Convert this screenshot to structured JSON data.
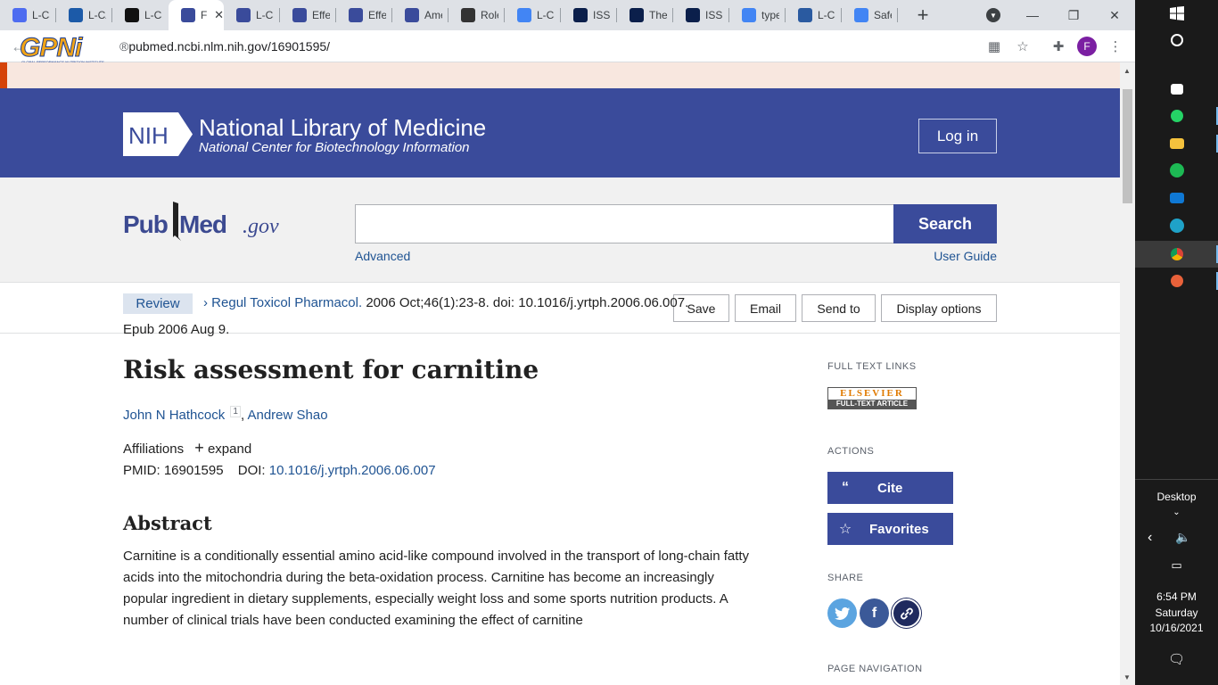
{
  "browser": {
    "tabs": [
      {
        "title": "L-Ca",
        "fav": "docs-icon",
        "color": "#4e6cf0"
      },
      {
        "title": "L-CA",
        "fav": "webmd-icon",
        "color": "#1c5aa8"
      },
      {
        "title": "L-Ca",
        "fav": "bolt-icon",
        "color": "#111111"
      },
      {
        "title": "F",
        "fav": "pubmed-tab-icon",
        "color": "#3a4b9b",
        "active": true
      },
      {
        "title": "L-Ca",
        "fav": "pubmed-tab-icon",
        "color": "#3a4b9b"
      },
      {
        "title": "Effe",
        "fav": "pubmed-tab-icon",
        "color": "#3a4b9b"
      },
      {
        "title": "Effe",
        "fav": "pubmed-tab-icon",
        "color": "#3a4b9b"
      },
      {
        "title": "Ame",
        "fav": "pubmed-tab-icon",
        "color": "#3a4b9b"
      },
      {
        "title": "Role",
        "fav": "dna-icon",
        "color": "#333333"
      },
      {
        "title": "L-Ca",
        "fav": "google-icon",
        "color": "#4285f4"
      },
      {
        "title": "ISSN",
        "fav": "issn-icon",
        "color": "#0b1f4b"
      },
      {
        "title": "The",
        "fav": "issn-icon",
        "color": "#0b1f4b"
      },
      {
        "title": "ISSN",
        "fav": "issn-icon",
        "color": "#0b1f4b"
      },
      {
        "title": "type",
        "fav": "google-icon",
        "color": "#4285f4"
      },
      {
        "title": "L-Ca",
        "fav": "site-icon",
        "color": "#2a5aa0"
      },
      {
        "title": "Safe",
        "fav": "google-icon",
        "color": "#4285f4"
      }
    ],
    "url": "pubmed.ncbi.nlm.nih.gov/16901595/",
    "profile_initial": "F",
    "overlay_logo": "GPNi",
    "overlay_logo_sub": "GLOBAL PERFORMANCE NUTRITION INSTITUTE"
  },
  "nih": {
    "logo": "NIH",
    "title": "National Library of Medicine",
    "subtitle": "National Center for Biotechnology Information",
    "login": "Log in"
  },
  "search": {
    "logo_pub": "Pub",
    "logo_med": "Med",
    "logo_gov": ".gov",
    "button": "Search",
    "advanced": "Advanced",
    "user_guide": "User Guide",
    "value": ""
  },
  "actions_bar": {
    "save": "Save",
    "email": "Email",
    "send_to": "Send to",
    "display_options": "Display options"
  },
  "article": {
    "badge": "Review",
    "journal": "Regul Toxicol Pharmacol.",
    "citation": " 2006 Oct;46(1):23-8. doi: 10.1016/j.yrtph.2006.06.007.",
    "epub": "Epub 2006 Aug 9.",
    "title": "Risk assessment for carnitine",
    "author1": "John N Hathcock",
    "author1_sup": "1",
    "author_sep": ",",
    "author2": "Andrew Shao",
    "affiliations": "Affiliations",
    "expand": "expand",
    "pmid_label": "PMID: 16901595",
    "doi_label": "DOI:",
    "doi": "10.1016/j.yrtph.2006.06.007",
    "abstract_heading": "Abstract",
    "abstract_text": "Carnitine is a conditionally essential amino acid-like compound involved in the transport of long-chain fatty acids into the mitochondria during the beta-oxidation process. Carnitine has become an increasingly popular ingredient in dietary supplements, especially weight loss and some sports nutrition products. A number of clinical trials have been conducted examining the effect of carnitine"
  },
  "sidebar": {
    "full_text_links": "FULL TEXT LINKS",
    "elsevier_top": "ELSEVIER",
    "elsevier_bottom": "FULL-TEXT ARTICLE",
    "actions": "ACTIONS",
    "cite": "Cite",
    "favorites": "Favorites",
    "share": "SHARE",
    "page_navigation": "PAGE NAVIGATION"
  },
  "taskbar": {
    "desktop": "Desktop",
    "time": "6:54 PM",
    "day": "Saturday",
    "date": "10/16/2021"
  }
}
